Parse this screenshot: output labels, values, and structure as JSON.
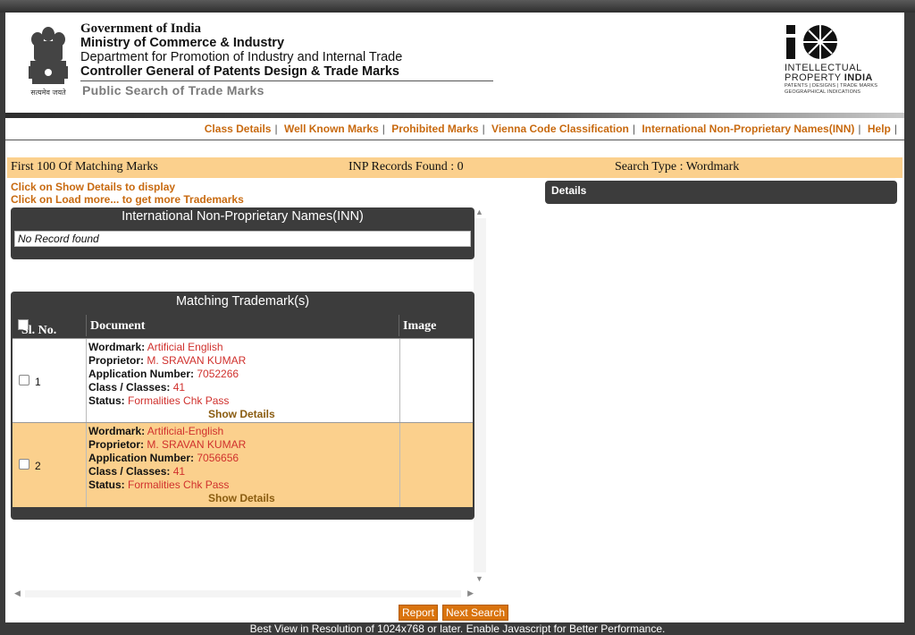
{
  "header": {
    "gov_title": "Government of India",
    "line1": "Ministry of Commerce & Industry",
    "line2": "Department for Promotion of Industry and Internal Trade",
    "line3": "Controller General of Patents Design & Trade Marks",
    "subtitle": "Public Search of Trade Marks",
    "emblem_caption": "सत्यमेव जयते",
    "logo": {
      "line1": "INTELLECTUAL",
      "line2a": "PROPERTY",
      "line2b": "INDIA",
      "line3": "PATENTS | DESIGNS | TRADE MARKS",
      "line4": "GEOGRAPHICAL INDICATIONS"
    }
  },
  "nav": {
    "class_details": "Class Details",
    "well_known": "Well Known Marks",
    "prohibited": "Prohibited Marks",
    "vienna": "Vienna Code Classification",
    "inn": "International Non-Proprietary Names(INN)",
    "help": "Help",
    "separator": "|"
  },
  "summary": {
    "left": "First 100 Of Matching Marks",
    "middle": "INP Records Found : 0",
    "right": "Search Type : Wordmark"
  },
  "hints": {
    "line1": "Click on Show Details to display",
    "line2": "Click on Load more... to get more Trademarks"
  },
  "details": {
    "title": "Details"
  },
  "inn_panel": {
    "title": "International Non-Proprietary Names(INN)",
    "empty": "No Record found"
  },
  "trademarks": {
    "title": "Matching Trademark(s)",
    "columns": {
      "sl": "Sl. No.",
      "doc": "Document",
      "image": "Image"
    },
    "labels": {
      "wordmark": "Wordmark:",
      "proprietor": "Proprietor:",
      "application": "Application Number:",
      "class": "Class / Classes:",
      "status": "Status:"
    },
    "rows": [
      {
        "sl": "1",
        "wordmark": "Artificial English",
        "proprietor": "M. SRAVAN KUMAR",
        "application": "7052266",
        "class": "41",
        "status": "Formalities Chk Pass",
        "show": "Show Details"
      },
      {
        "sl": "2",
        "wordmark": "Artificial-English",
        "proprietor": "M. SRAVAN KUMAR",
        "application": "7056656",
        "class": "41",
        "status": "Formalities Chk Pass",
        "show": "Show Details"
      }
    ]
  },
  "buttons": {
    "report": "Report",
    "next": "Next Search"
  },
  "footer": "Best View in Resolution of 1024x768 or later. Enable Javascript for Better Performance.",
  "colors": {
    "accent_orange": "#c86a10",
    "highlight": "#fbd08d",
    "value_red": "#d0312d",
    "panel_dark": "#3c3c3c",
    "button": "#d9730d"
  }
}
